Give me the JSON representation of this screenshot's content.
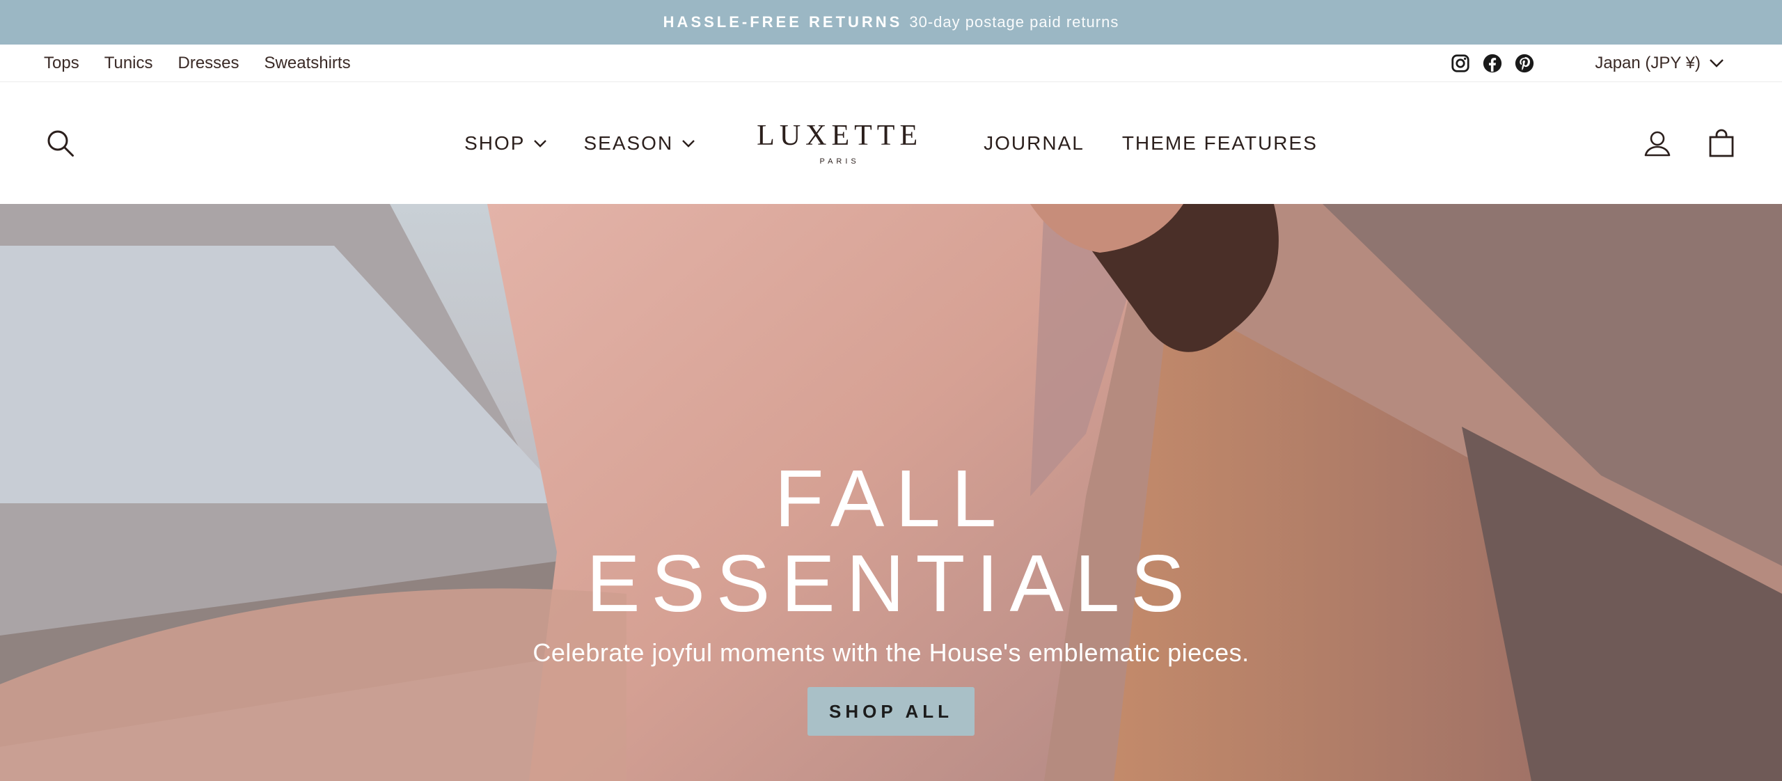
{
  "announcement": {
    "bold": "HASSLE-FREE RETURNS",
    "text": "30-day postage paid returns"
  },
  "utility_nav": {
    "links": [
      "Tops",
      "Tunics",
      "Dresses",
      "Sweatshirts"
    ],
    "social_icons": [
      "instagram-icon",
      "facebook-icon",
      "pinterest-icon"
    ],
    "currency": "Japan (JPY ¥)"
  },
  "header": {
    "nav_left": [
      "SHOP",
      "SEASON"
    ],
    "nav_right": [
      "JOURNAL",
      "THEME FEATURES"
    ],
    "logo": {
      "word": "LUXETTE",
      "sub": "PARIS"
    },
    "icons": [
      "search-icon",
      "account-icon",
      "cart-icon"
    ]
  },
  "hero": {
    "title_line1": "FALL",
    "title_line2": "ESSENTIALS",
    "subtitle": "Celebrate joyful moments with the House's emblematic pieces.",
    "button": "SHOP ALL"
  },
  "colors": {
    "announcement_bg": "#9bb7c4",
    "button_bg": "#a9c0c7",
    "text": "#2b1f1c"
  }
}
